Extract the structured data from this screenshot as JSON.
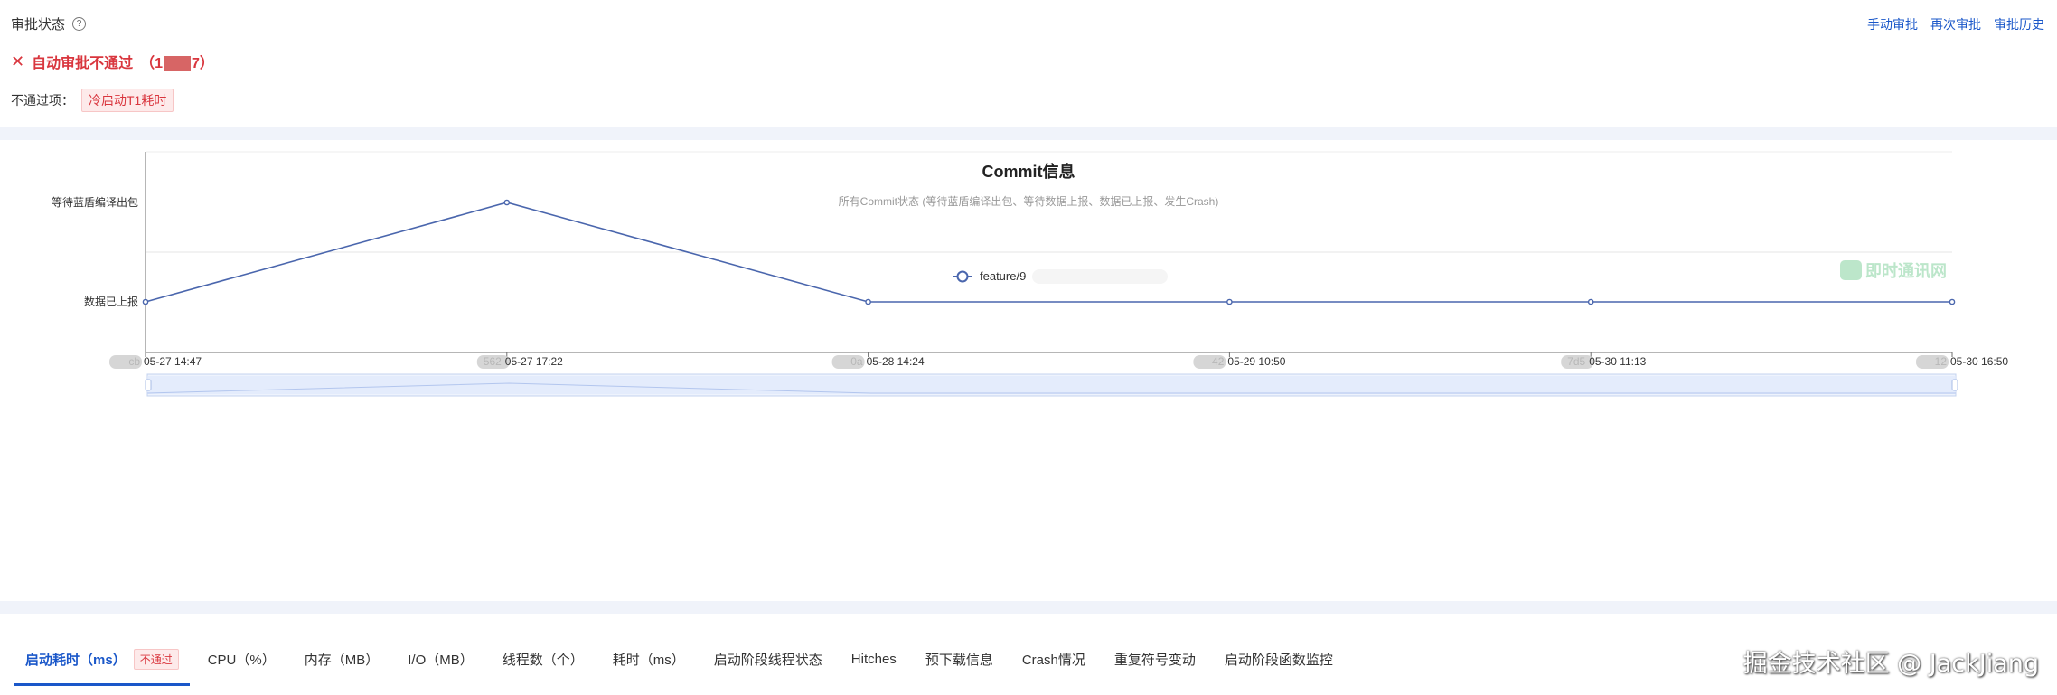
{
  "approval": {
    "title": "审批状态",
    "help_icon": "?",
    "actions": [
      "手动审批",
      "再次审批",
      "审批历史"
    ],
    "status_text": "自动审批不通过",
    "status_id_prefix": "（1",
    "status_id_suffix": "7）",
    "failed_items_label": "不通过项：",
    "failed_items": [
      "冷启动T1耗时"
    ]
  },
  "chart_data": {
    "type": "line",
    "title": "Commit信息",
    "subtitle": "所有Commit状态 (等待蓝盾编译出包、等待数据上报、数据已上报、发生Crash)",
    "y_categories": [
      "数据已上报",
      "等待数据上报",
      "等待蓝盾编译出包"
    ],
    "x": [
      {
        "id_prefix": "cb",
        "time": "05-27 14:47"
      },
      {
        "id_prefix": "562",
        "time": "05-27 17:22"
      },
      {
        "id_prefix": "0a",
        "time": "05-28 14:24"
      },
      {
        "id_prefix": "42",
        "time": "05-29 10:50"
      },
      {
        "id_prefix": "7d5",
        "time": "05-30 11:13"
      },
      {
        "id_prefix": "12",
        "time": "05-30 16:50"
      }
    ],
    "series": [
      {
        "name": "feature/9",
        "color": "#4a66ad",
        "values": [
          "数据已上报",
          "等待蓝盾编译出包",
          "数据已上报",
          "数据已上报",
          "数据已上报",
          "数据已上报"
        ]
      }
    ],
    "grid": true,
    "legend_position": "center",
    "data_zoom": true
  },
  "logo_watermark": "即时通讯网",
  "tabs": [
    {
      "label": "启动耗时（ms）",
      "badge": "不通过",
      "active": true
    },
    {
      "label": "CPU（%）"
    },
    {
      "label": "内存（MB）"
    },
    {
      "label": "I/O（MB）"
    },
    {
      "label": "线程数（个）"
    },
    {
      "label": "耗时（ms）"
    },
    {
      "label": "启动阶段线程状态"
    },
    {
      "label": "Hitches"
    },
    {
      "label": "预下载信息"
    },
    {
      "label": "Crash情况"
    },
    {
      "label": "重复符号变动"
    },
    {
      "label": "启动阶段函数监控"
    }
  ],
  "site_watermark": "掘金技术社区 @ JackJiang",
  "colors": {
    "accent": "#1a57c9",
    "danger": "#d9363e",
    "line": "#4a66ad"
  }
}
